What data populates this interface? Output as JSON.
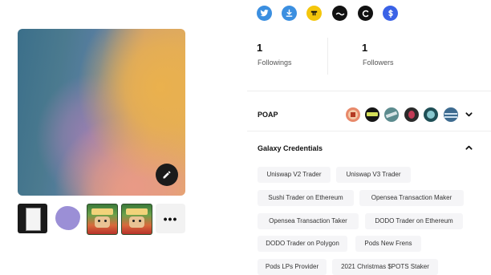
{
  "socials": [
    {
      "name": "twitter-icon",
      "color": "#3b8fe0"
    },
    {
      "name": "download-icon",
      "color": "#3b8fe0"
    },
    {
      "name": "rabbit-hole-icon",
      "color": "#f4c60c"
    },
    {
      "name": "mirror-icon",
      "color": "#111111"
    },
    {
      "name": "c-logo-icon",
      "color": "#111111"
    },
    {
      "name": "dollar-icon",
      "color": "#3a62e6"
    }
  ],
  "stats": {
    "followings_count": "1",
    "followings_label": "Followings",
    "followers_count": "1",
    "followers_label": "Followers"
  },
  "poap": {
    "title": "POAP",
    "badges": [
      "poap-badge-1",
      "poap-badge-2",
      "poap-badge-3",
      "poap-badge-4",
      "poap-badge-5",
      "poap-badge-6"
    ]
  },
  "galaxy": {
    "title": "Galaxy Credentials",
    "credentials": [
      "Uniswap V2 Trader",
      "Uniswap V3 Trader",
      "Sushi Trader on Ethereum",
      "Opensea Transaction Maker",
      "Opensea Transaction Taker",
      "DODO Trader on Ethereum",
      "DODO Trader on Polygon",
      "Pods New Frens",
      "Pods LPs Provider",
      "2021 Christmas $POTS Staker"
    ]
  },
  "thumbs": {
    "more_label": "•••"
  }
}
